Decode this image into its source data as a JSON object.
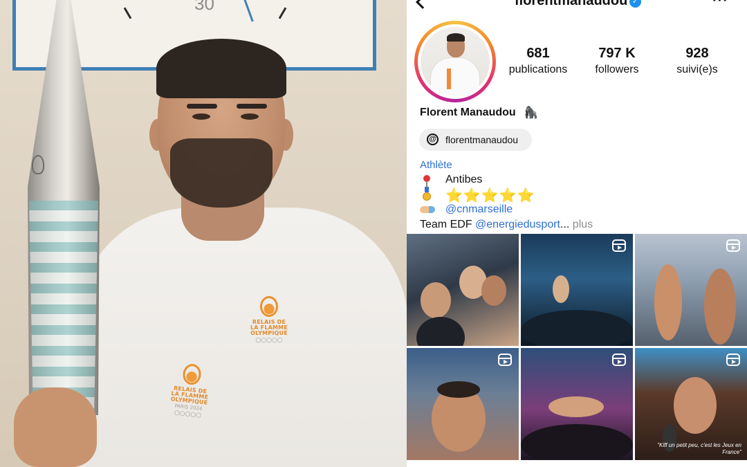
{
  "photo": {
    "clock_number": "30",
    "emblem_chest": {
      "line1": "RELAIS DE",
      "line2": "LA FLAMME",
      "line3": "OLYMPIQUE",
      "sub": "PARIS 2024"
    },
    "emblem_sleeve": {
      "line1": "RELAIS DE",
      "line2": "LA FLAMME",
      "line3": "OLYMPIQUE",
      "sub": "PARIS 2024"
    }
  },
  "profile": {
    "username": "florentmanaudou",
    "verified": true,
    "verified_glyph": "✓",
    "more_glyph": "···",
    "stats": [
      {
        "value": "681",
        "label": "publications"
      },
      {
        "value": "797 K",
        "label": "followers"
      },
      {
        "value": "928",
        "label": "suivi(e)s"
      }
    ],
    "full_name": "Florent Manaudou",
    "name_emoji": "🦍",
    "threads": {
      "glyph": "@",
      "handle": "florentmanaudou"
    },
    "category": "Athlète",
    "bio": {
      "location": "Antibes",
      "stars": "⭐⭐⭐⭐⭐",
      "club": "@cnmarseille",
      "team_prefix": "Team EDF ",
      "team_mention": "@energiedusport",
      "ellipsis": "...",
      "more": " plus"
    },
    "grid_caption": "\"Kiff un petit peu, c'est les Jeux en France\"",
    "colors": {
      "link": "#2d6fd2",
      "verified": "#1d8ff1"
    }
  }
}
